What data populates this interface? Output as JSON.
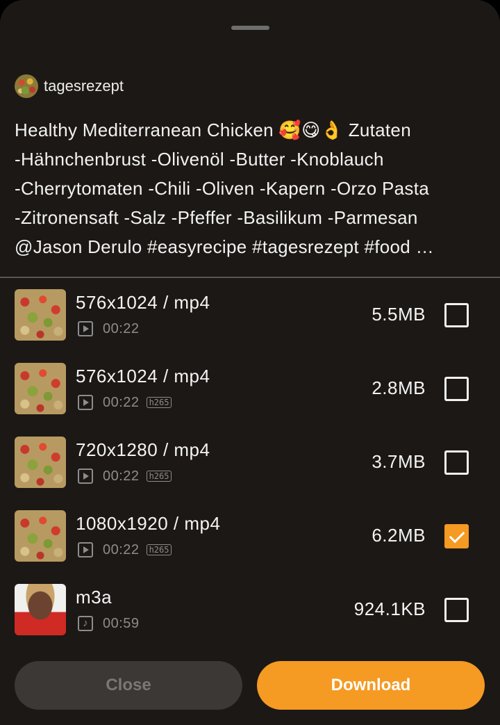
{
  "author": {
    "name": "tagesrezept"
  },
  "description": "Healthy Mediterranean Chicken 🥰😋👌 Zutaten\n-Hähnchenbrust -Olivenöl -Butter -Knoblauch\n-Cherrytomaten -Chili -Oliven -Kapern -Orzo Pasta\n-Zitronensaft -Salz -Pfeffer -Basilikum -Parmesan\n@Jason Derulo #easyrecipe #tagesrezept #food …",
  "items": [
    {
      "title": "576x1024 / mp4",
      "duration": "00:22",
      "codec": "",
      "size": "5.5MB",
      "checked": false,
      "icon": "play-icon"
    },
    {
      "title": "576x1024 / mp4",
      "duration": "00:22",
      "codec": "h265",
      "size": "2.8MB",
      "checked": false,
      "icon": "play-icon"
    },
    {
      "title": "720x1280 / mp4",
      "duration": "00:22",
      "codec": "h265",
      "size": "3.7MB",
      "checked": false,
      "icon": "play-icon"
    },
    {
      "title": "1080x1920 / mp4",
      "duration": "00:22",
      "codec": "h265",
      "size": "6.2MB",
      "checked": true,
      "icon": "play-icon"
    },
    {
      "title": "m3a",
      "duration": "00:59",
      "codec": "",
      "size": "924.1KB",
      "checked": false,
      "icon": "music-note-icon"
    }
  ],
  "buttons": {
    "close": "Close",
    "download": "Download"
  },
  "colors": {
    "accent": "#f59a23",
    "background": "#1c1815"
  }
}
